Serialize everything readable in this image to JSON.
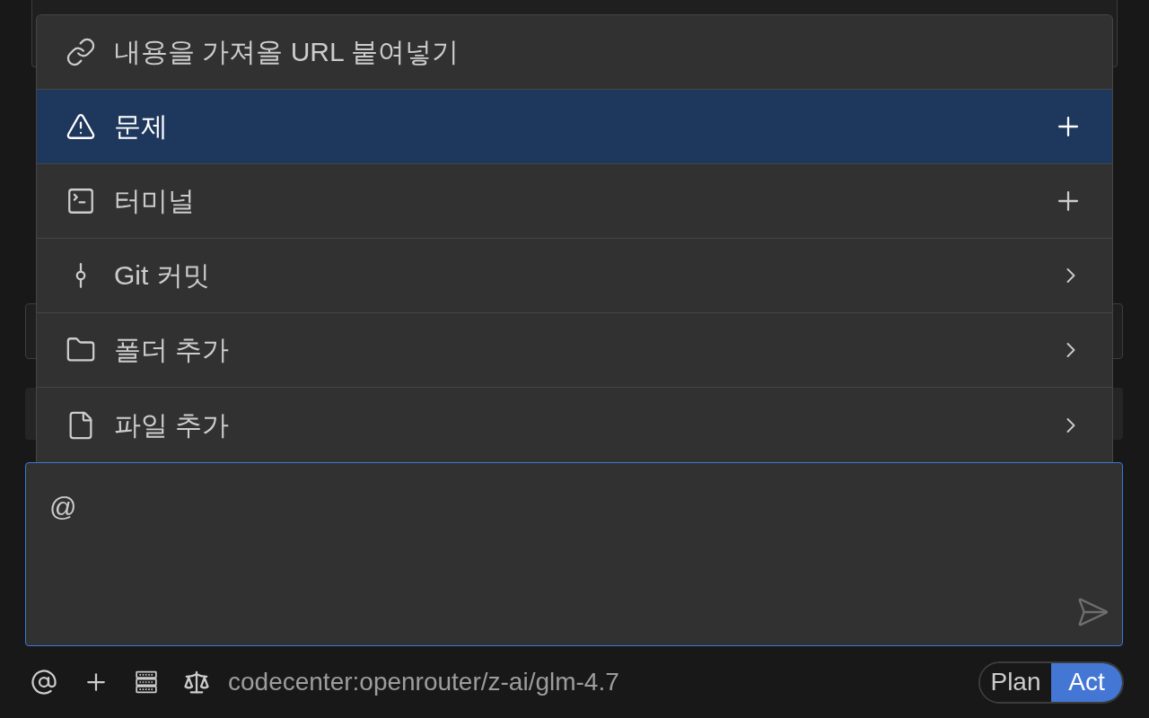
{
  "menu": {
    "items": [
      {
        "kind": "link",
        "label": "내용을 가져올 URL 붙여넣기",
        "selected": false,
        "addable": false,
        "submenu": false
      },
      {
        "kind": "warning",
        "label": "문제",
        "selected": true,
        "addable": true,
        "submenu": false
      },
      {
        "kind": "terminal",
        "label": "터미널",
        "selected": false,
        "addable": true,
        "submenu": false
      },
      {
        "kind": "git-commit",
        "label": "Git 커밋",
        "selected": false,
        "addable": false,
        "submenu": true
      },
      {
        "kind": "folder",
        "label": "폴더 추가",
        "selected": false,
        "addable": false,
        "submenu": true
      },
      {
        "kind": "file",
        "label": "파일 추가",
        "selected": false,
        "addable": false,
        "submenu": true
      }
    ]
  },
  "input": {
    "value": "@"
  },
  "toolbar": {
    "model": "codecenter:openrouter/z-ai/glm-4.7"
  },
  "mode_toggle": [
    {
      "label": "Plan",
      "selected": false
    },
    {
      "label": "Act",
      "selected": true
    }
  ]
}
